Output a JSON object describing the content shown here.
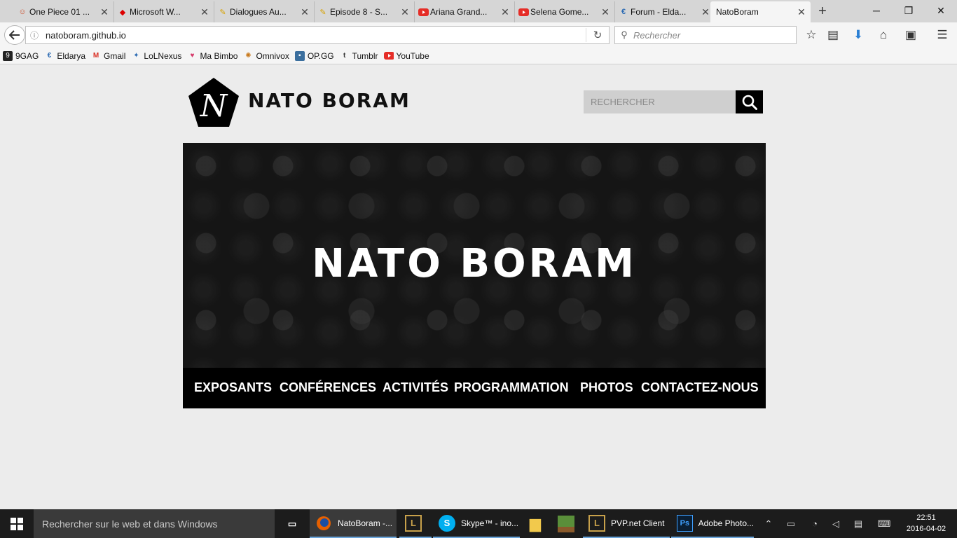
{
  "browser": {
    "tabs": [
      {
        "label": "One Piece 01 ...",
        "icon": "luffy-icon"
      },
      {
        "label": "Microsoft W...",
        "icon": "red-dot-icon"
      },
      {
        "label": "Dialogues Au...",
        "icon": "pencil-icon"
      },
      {
        "label": "Episode 8 - S...",
        "icon": "pencil-icon"
      },
      {
        "label": "Ariana Grand...",
        "icon": "youtube-icon"
      },
      {
        "label": "Selena Gome...",
        "icon": "youtube-icon"
      },
      {
        "label": "Forum - Elda...",
        "icon": "eldarya-icon"
      },
      {
        "label": "NatoBoram",
        "icon": "none",
        "active": true
      }
    ],
    "url": "natoboram.github.io",
    "search_placeholder": "Rechercher",
    "bookmarks": [
      {
        "label": "9GAG",
        "icon": "9gag-icon"
      },
      {
        "label": "Eldarya",
        "icon": "eldarya-icon"
      },
      {
        "label": "Gmail",
        "icon": "gmail-icon"
      },
      {
        "label": "LoLNexus",
        "icon": "lolnexus-icon"
      },
      {
        "label": "Ma Bimbo",
        "icon": "heart-icon"
      },
      {
        "label": "Omnivox",
        "icon": "omnivox-icon"
      },
      {
        "label": "OP.GG",
        "icon": "opgg-icon"
      },
      {
        "label": "Tumblr",
        "icon": "tumblr-icon"
      },
      {
        "label": "YouTube",
        "icon": "youtube-icon"
      }
    ]
  },
  "site": {
    "logo_letter": "N",
    "logo_text": "NATO BORAM",
    "search_placeholder": "RECHERCHER",
    "hero_title": "NATO BORAM",
    "menu": [
      "EXPOSANTS",
      "CONFÉRENCES",
      "ACTIVITÉS",
      "PROGRAMMATION",
      "PHOTOS",
      "CONTACTEZ-NOUS"
    ]
  },
  "taskbar": {
    "search_text": "Rechercher sur le web et dans Windows",
    "apps": [
      {
        "label": "NatoBoram -...",
        "icon": "firefox-icon"
      },
      {
        "label": "",
        "icon": "league-icon"
      },
      {
        "label": "Skype™ - ino...",
        "icon": "skype-icon"
      },
      {
        "label": "",
        "icon": "folder-icon"
      },
      {
        "label": "",
        "icon": "minecraft-icon"
      },
      {
        "label": "PVP.net Client",
        "icon": "pvpnet-icon"
      },
      {
        "label": "Adobe Photo...",
        "icon": "photoshop-icon"
      }
    ],
    "time": "22:51",
    "date": "2016-04-02"
  },
  "colors": {
    "page_bg": "#ececec",
    "menu_bg": "#000000",
    "accent_blue": "#2a7fd4"
  }
}
